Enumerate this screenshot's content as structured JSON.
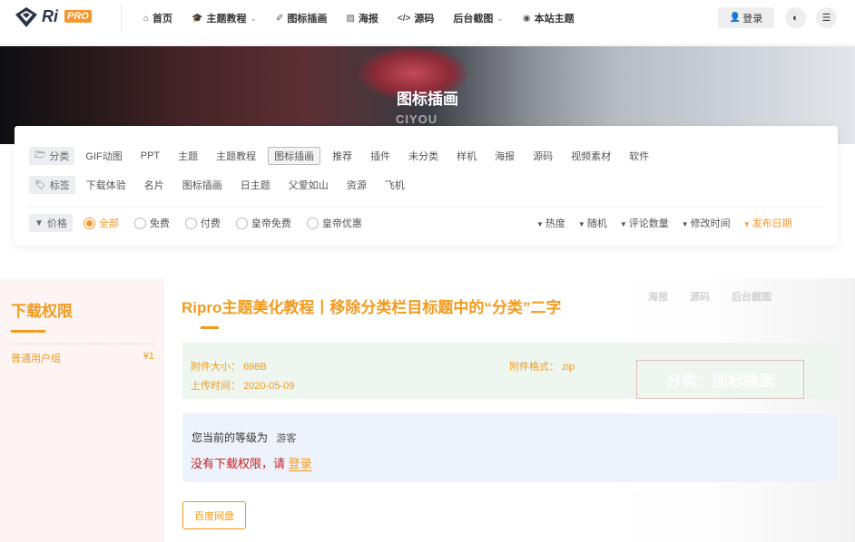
{
  "header": {
    "logo_text": "Ri",
    "logo_pro": "PRO",
    "nav": [
      {
        "icon": "home-icon",
        "glyph": "⌂",
        "label": "首页"
      },
      {
        "icon": "graduation-cap-icon",
        "glyph": "🎓",
        "label": "主题教程",
        "dropdown": true
      },
      {
        "icon": "brush-icon",
        "glyph": "✐",
        "label": "图标插画"
      },
      {
        "icon": "image-icon",
        "glyph": "▨",
        "label": "海报"
      },
      {
        "icon": "code-icon",
        "glyph": "</>",
        "label": "源码"
      },
      {
        "label": "后台截图",
        "dropdown": true
      },
      {
        "icon": "target-icon",
        "glyph": "◉",
        "label": "本站主题"
      }
    ],
    "login_label": "登录"
  },
  "hero": {
    "title": "图标插画",
    "brand": "CIYOU"
  },
  "filter": {
    "category_label": "分类",
    "categories": [
      "GIF动图",
      "PPT",
      "主题",
      "主题教程",
      "图标插画",
      "推荐",
      "插件",
      "未分类",
      "样机",
      "海报",
      "源码",
      "视频素材",
      "软件"
    ],
    "active_category": "图标插画",
    "tag_label": "标签",
    "tags": [
      "下载体验",
      "名片",
      "图标插画",
      "日主题",
      "父爱如山",
      "资源",
      "飞机"
    ],
    "price_label": "价格",
    "price_options": [
      "全部",
      "免费",
      "付费",
      "皇帝免费",
      "皇帝优惠"
    ],
    "price_selected": "全部",
    "sort_options": [
      "热度",
      "随机",
      "评论数量",
      "修改时间",
      "发布日期"
    ],
    "sort_active": "发布日期"
  },
  "sidebar": {
    "title": "下载权限",
    "rows": [
      {
        "group": "普通用户组",
        "price": "¥1"
      }
    ]
  },
  "ghost": {
    "nav": [
      "海报",
      "源码",
      "后台截图"
    ],
    "box_text": "分类：图标插画"
  },
  "post": {
    "title": "Ripro主题美化教程丨移除分类栏目标题中的“分类”二字",
    "size_label": "附件大小：",
    "size_value": "698B",
    "format_label": "附件格式：",
    "format_value": "zip",
    "upload_label": "上传时间：",
    "upload_value": "2020-05-09",
    "level_text": "您当前的等级为",
    "level_value": "游客",
    "deny_text": "没有下载权限，请",
    "deny_link": "登录",
    "download_button": "百度网盘"
  },
  "colors": {
    "accent": "#f39a1c",
    "deny": "#c62222",
    "info_bg": "#eef6ef",
    "perm_bg": "#eef2fb"
  }
}
